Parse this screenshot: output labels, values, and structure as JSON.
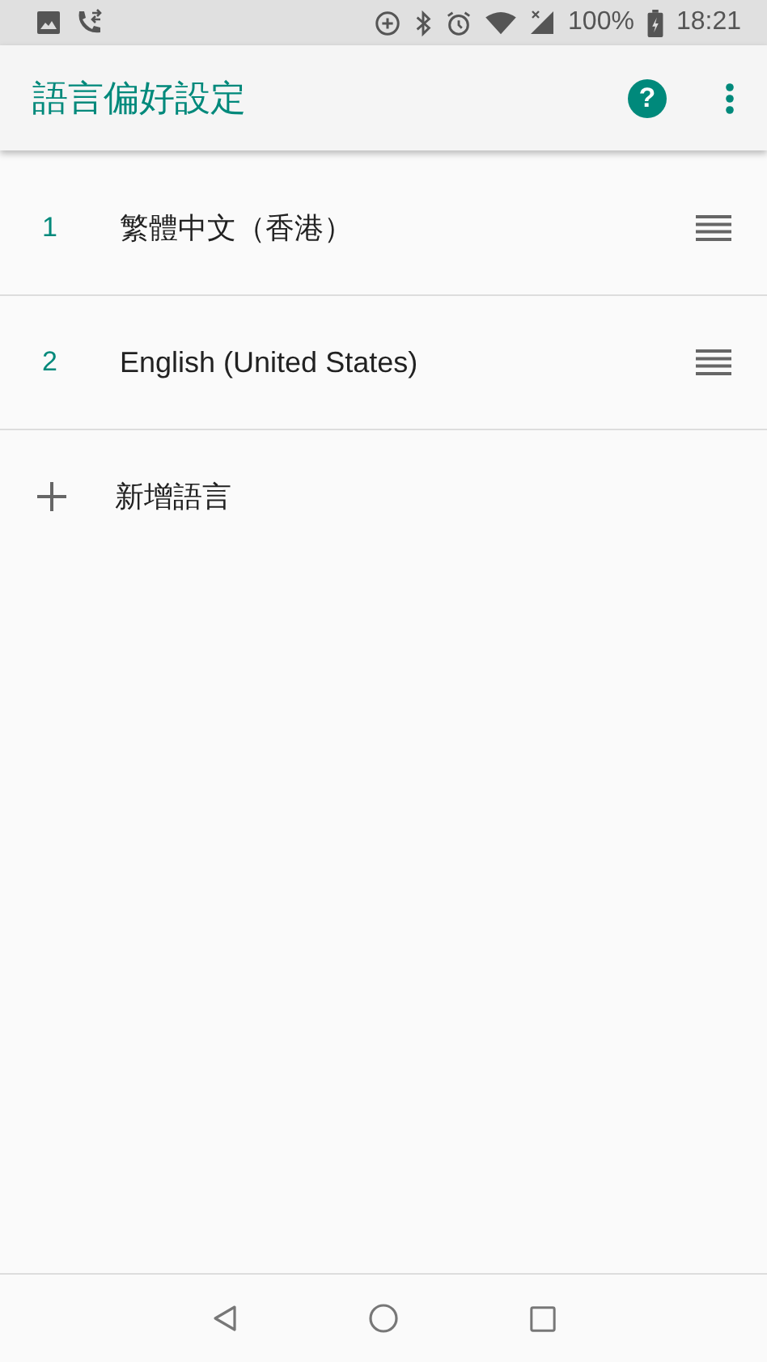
{
  "status_bar": {
    "battery": "100%",
    "time": "18:21"
  },
  "app_bar": {
    "title": "語言偏好設定",
    "help_icon": "?"
  },
  "languages": [
    {
      "number": "1",
      "name": "繁體中文（香港）"
    },
    {
      "number": "2",
      "name": "English (United States)"
    }
  ],
  "add_language": {
    "label": "新增語言"
  }
}
